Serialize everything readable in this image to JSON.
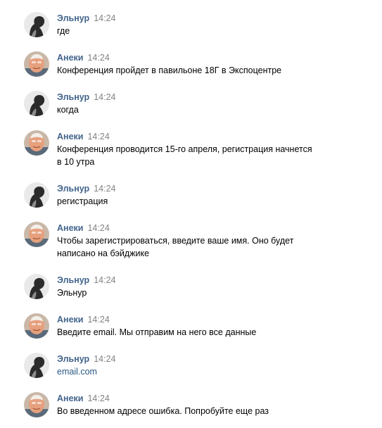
{
  "messages": [
    {
      "author": "Эльнур",
      "time": "14:24",
      "text": "где",
      "avatar": "elnur-avatar",
      "is_link": false
    },
    {
      "author": "Анеки",
      "time": "14:24",
      "text": "Конференция пройдет в павильоне 18Г в Экспоцентре",
      "avatar": "aneki-avatar",
      "is_link": false
    },
    {
      "author": "Эльнур",
      "time": "14:24",
      "text": "когда",
      "avatar": "elnur-avatar",
      "is_link": false
    },
    {
      "author": "Анеки",
      "time": "14:24",
      "text": "Конференция проводится 15-го апреля, регистрация начнется\nв 10 утра",
      "avatar": "aneki-avatar",
      "is_link": false
    },
    {
      "author": "Эльнур",
      "time": "14:24",
      "text": "регистрация",
      "avatar": "elnur-avatar",
      "is_link": false
    },
    {
      "author": "Анеки",
      "time": "14:24",
      "text": "Чтобы зарегистрироваться, введите ваше имя. Оно будет\nнаписано на бэйджике",
      "avatar": "aneki-avatar",
      "is_link": false
    },
    {
      "author": "Эльнур",
      "time": "14:24",
      "text": "Эльнур",
      "avatar": "elnur-avatar",
      "is_link": false
    },
    {
      "author": "Анеки",
      "time": "14:24",
      "text": "Введите email. Мы отправим на него все данные",
      "avatar": "aneki-avatar",
      "is_link": false
    },
    {
      "author": "Эльнур",
      "time": "14:24",
      "text": "email.com",
      "avatar": "elnur-avatar",
      "is_link": true
    },
    {
      "author": "Анеки",
      "time": "14:24",
      "text": "Во введенном адресе ошибка. Попробуйте еще раз",
      "avatar": "aneki-avatar",
      "is_link": false
    }
  ],
  "colors": {
    "author": "#42648b",
    "time": "#828282",
    "text": "#000000",
    "link": "#2a5885"
  }
}
